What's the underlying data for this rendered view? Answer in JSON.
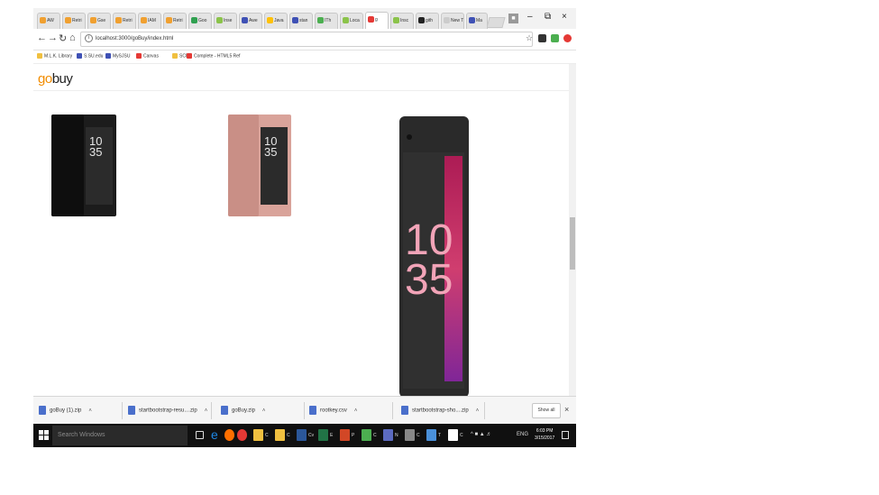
{
  "tabs": [
    {
      "label": "AW",
      "color": "#f0a030"
    },
    {
      "label": "Retri",
      "color": "#f0a030"
    },
    {
      "label": "Gse",
      "color": "#f0a030"
    },
    {
      "label": "Retri",
      "color": "#f0a030"
    },
    {
      "label": "IAM",
      "color": "#f0a030"
    },
    {
      "label": "Retri",
      "color": "#f0a030"
    },
    {
      "label": "Goo",
      "color": "#30a050"
    },
    {
      "label": "Inse",
      "color": "#8bc34a"
    },
    {
      "label": "Awe",
      "color": "#3f51b5"
    },
    {
      "label": "Java",
      "color": "#ffc107"
    },
    {
      "label": "stan",
      "color": "#3f51b5"
    },
    {
      "label": "ITh",
      "color": "#4caf50"
    },
    {
      "label": "Loca",
      "color": "#8bc34a"
    },
    {
      "label": "g",
      "color": "#e53935",
      "active": true
    },
    {
      "label": "Insc",
      "color": "#8bc34a"
    },
    {
      "label": "gith",
      "color": "#222222"
    },
    {
      "label": "New Tab",
      "color": "#cccccc"
    },
    {
      "label": "Ma",
      "color": "#3f51b5"
    }
  ],
  "toolbar": {
    "url": "localhost:3000/goBuy/index.html"
  },
  "bookmarks": [
    {
      "label": "M.L.K. Library",
      "color": "#f0c040"
    },
    {
      "label": "S.SU.edu",
      "color": "#3f51b5"
    },
    {
      "label": "MySJSU",
      "color": "#3f51b5"
    },
    {
      "label": "Canvas",
      "color": "#e53935"
    },
    {
      "label": "SCE",
      "color": "#f0c040"
    },
    {
      "label": "Complete - HTML5 Ref",
      "color": "#e53935"
    }
  ],
  "logo": {
    "go": "go",
    "buy": "buy"
  },
  "phones": [
    {
      "clock_h": "10",
      "clock_m": "35",
      "color": "#1c1c1c"
    },
    {
      "clock_h": "10",
      "clock_m": "35",
      "color": "#d9a39a"
    },
    {
      "clock_h": "10",
      "clock_m": "35",
      "color": "#2a2a2a"
    }
  ],
  "downloads": {
    "items": [
      {
        "name": "goBuy (1).zip"
      },
      {
        "name": "startbootstrap-resu....zip"
      },
      {
        "name": "goBuy.zip"
      },
      {
        "name": "rootkey.csv"
      },
      {
        "name": "startbootstrap-sho....zip"
      }
    ],
    "show_all": "Show all"
  },
  "taskbar": {
    "search_placeholder": "Search Windows",
    "apps": [
      {
        "label": "C",
        "color": "#f0c040"
      },
      {
        "label": "C",
        "color": "#f0c040"
      },
      {
        "label": "Cv",
        "color": "#2b579a"
      },
      {
        "label": "E",
        "color": "#217346"
      },
      {
        "label": "P",
        "color": "#d24726"
      },
      {
        "label": "C",
        "color": "#4caf50"
      },
      {
        "label": "N",
        "color": "#5c6bc0"
      },
      {
        "label": "C",
        "color": "#888888"
      },
      {
        "label": "T",
        "color": "#4a90d9"
      },
      {
        "label": "C",
        "color": "#ffffff"
      }
    ],
    "tray_lang": "ENG",
    "time": "6:03 PM",
    "date": "3/15/2017"
  }
}
